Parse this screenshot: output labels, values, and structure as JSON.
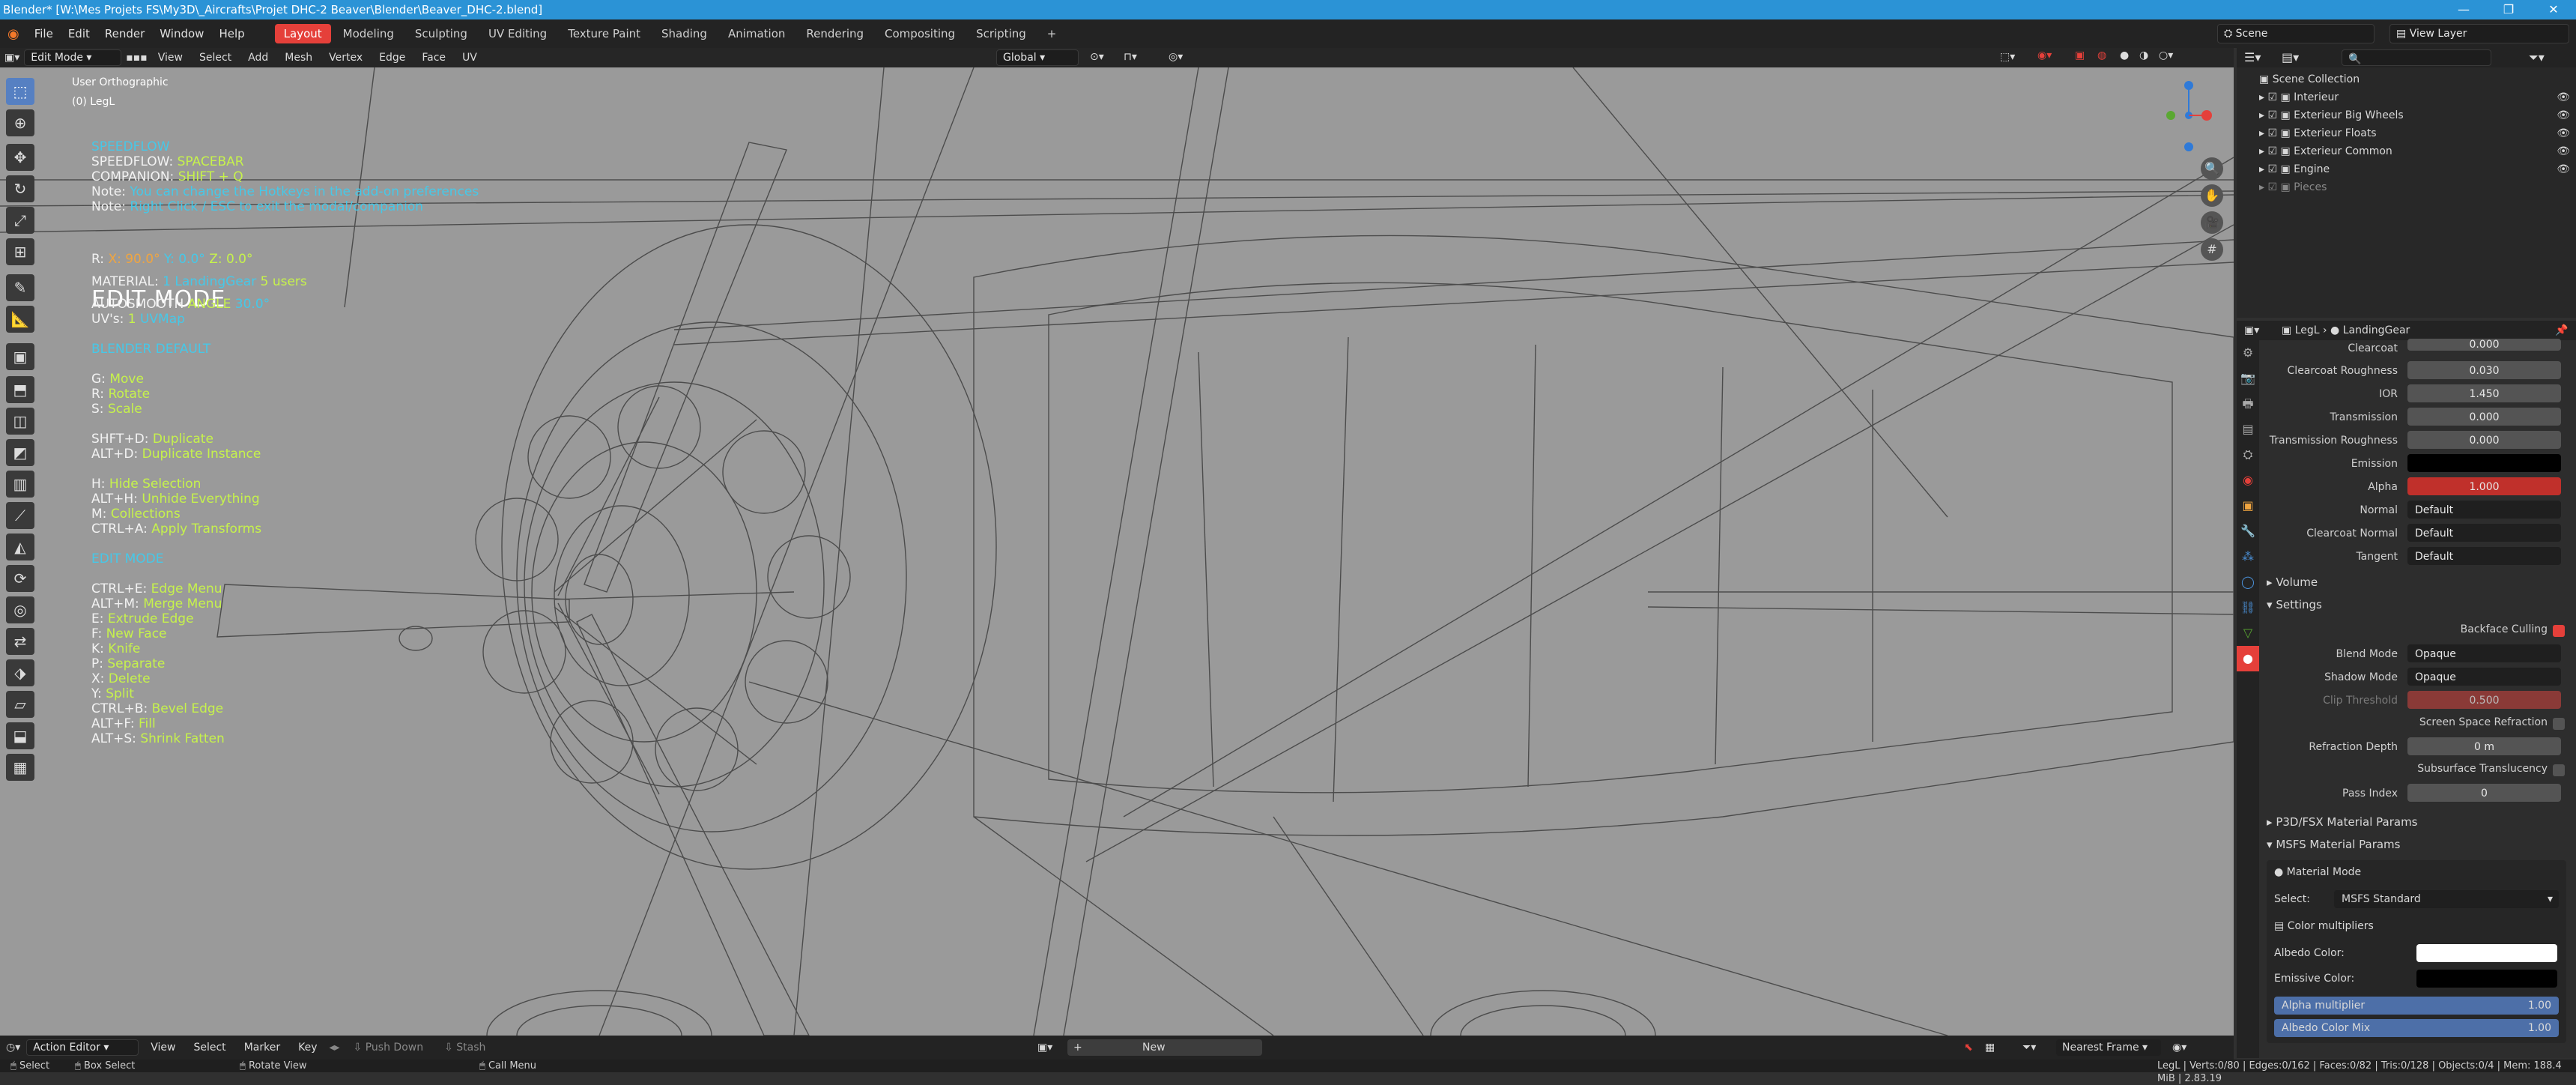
{
  "window": {
    "title": "Blender* [W:\\Mes Projets FS\\My3D\\_Aircrafts\\Projet DHC-2 Beaver\\Blender\\Beaver_DHC-2.blend]"
  },
  "menu": [
    "File",
    "Edit",
    "Render",
    "Window",
    "Help"
  ],
  "workspaces": [
    "Layout",
    "Modeling",
    "Sculpting",
    "UV Editing",
    "Texture Paint",
    "Shading",
    "Animation",
    "Rendering",
    "Compositing",
    "Scripting"
  ],
  "active_workspace": "Layout",
  "scene": "Scene",
  "view_layer": "View Layer",
  "viewport": {
    "mode": "Edit Mode",
    "menus": [
      "View",
      "Select",
      "Add",
      "Mesh",
      "Vertex",
      "Edge",
      "Face",
      "UV"
    ],
    "orientation": "Global",
    "view_label": "User Orthographic",
    "object_label": "(0) LegL"
  },
  "overlay": {
    "title_line": "SPEEDFLOW",
    "speedflow_key": "SPEEDFLOW:",
    "speedflow_val": "SPACEBAR",
    "companion_key": "COMPANION:",
    "companion_val": "SHIFT + Q",
    "note1_key": "Note:",
    "note1_val": "You can change the Hotkeys in the add-on preferences",
    "note2_key": "Note:",
    "note2_val": "Right Click / ESC to exit the modal/companion",
    "mode": "EDIT MODE",
    "r_line_key": "R:",
    "r_x": "X: 90.0°",
    "r_y": "Y: 0.0°",
    "r_z": "Z: 0.0°",
    "material_key": "MATERIAL:",
    "material_count": "1",
    "material_name": "LandingGear",
    "material_users": "5 users",
    "autosmooth_key": "AUTOSMOOTH",
    "autosmooth_angle": "ANGLE",
    "autosmooth_val": "30.0°",
    "uvs_key": "UV's:",
    "uvs_count": "1",
    "uvs_name": "UVMap",
    "section1": "BLENDER DEFAULT",
    "shortcuts1": [
      {
        "k": "G:",
        "v": "Move"
      },
      {
        "k": "R:",
        "v": "Rotate"
      },
      {
        "k": "S:",
        "v": "Scale"
      }
    ],
    "shortcuts2": [
      {
        "k": "SHFT+D:",
        "v": "Duplicate"
      },
      {
        "k": "ALT+D:",
        "v": "Duplicate Instance"
      }
    ],
    "shortcuts3": [
      {
        "k": "H:",
        "v": "Hide Selection"
      },
      {
        "k": "ALT+H:",
        "v": "Unhide Everything"
      },
      {
        "k": "M:",
        "v": "Collections"
      },
      {
        "k": "CTRL+A:",
        "v": "Apply Transforms"
      }
    ],
    "section2": "EDIT MODE",
    "shortcuts4": [
      {
        "k": "CTRL+E:",
        "v": "Edge Menu"
      },
      {
        "k": "ALT+M:",
        "v": "Merge Menu"
      },
      {
        "k": "E:",
        "v": "Extrude Edge"
      },
      {
        "k": "F:",
        "v": "New Face"
      },
      {
        "k": "K:",
        "v": "Knife"
      },
      {
        "k": "P:",
        "v": "Separate"
      },
      {
        "k": "X:",
        "v": "Delete"
      },
      {
        "k": "Y:",
        "v": "Split"
      },
      {
        "k": "CTRL+B:",
        "v": "Bevel Edge"
      },
      {
        "k": "ALT+F:",
        "v": "Fill"
      },
      {
        "k": "ALT+S:",
        "v": "Shrink Fatten"
      }
    ]
  },
  "outliner": {
    "root": "Scene Collection",
    "items": [
      "Interieur",
      "Exterieur Big Wheels",
      "Exterieur Floats",
      "Exterieur Common",
      "Engine",
      "Pieces"
    ]
  },
  "properties": {
    "breadcrumb_object": "LegL",
    "breadcrumb_material": "LandingGear",
    "rows": [
      {
        "label": "Clearcoat",
        "value": "0.000"
      },
      {
        "label": "Clearcoat Roughness",
        "value": "0.030"
      },
      {
        "label": "IOR",
        "value": "1.450"
      },
      {
        "label": "Transmission",
        "value": "0.000"
      },
      {
        "label": "Transmission Roughness",
        "value": "0.000"
      },
      {
        "label": "Emission",
        "value": ""
      },
      {
        "label": "Alpha",
        "value": "1.000"
      },
      {
        "label": "Normal",
        "value": "Default"
      },
      {
        "label": "Clearcoat Normal",
        "value": "Default"
      },
      {
        "label": "Tangent",
        "value": "Default"
      }
    ],
    "volume": "Volume",
    "settings": "Settings",
    "backface_culling": "Backface Culling",
    "blend_mode_label": "Blend Mode",
    "blend_mode": "Opaque",
    "shadow_mode_label": "Shadow Mode",
    "shadow_mode": "Opaque",
    "clip_label": "Clip Threshold",
    "clip_value": "0.500",
    "ssr_label": "Screen Space Refraction",
    "refr_depth_label": "Refraction Depth",
    "refr_depth": "0 m",
    "sss_label": "Subsurface Translucency",
    "pass_index_label": "Pass Index",
    "pass_index": "0",
    "p3d_panel": "P3D/FSX Material Params",
    "msfs_panel": "MSFS Material Params",
    "material_mode": "Material Mode",
    "select_label": "Select:",
    "select_value": "MSFS Standard",
    "color_mult": "Color multipliers",
    "albedo_label": "Albedo Color:",
    "emissive_label": "Emissive Color:",
    "alpha_mult_label": "Alpha multiplier",
    "alpha_mult": "1.00",
    "albedo_mix_label": "Albedo Color Mix",
    "albedo_mix": "1.00"
  },
  "timeline": {
    "editor": "Action Editor",
    "menus": [
      "View",
      "Select",
      "Marker",
      "Key"
    ],
    "push_down": "Push Down",
    "stash": "Stash",
    "new": "New",
    "snap": "Nearest Frame"
  },
  "status": {
    "select": "Select",
    "box_select": "Box Select",
    "rotate_view": "Rotate View",
    "call_menu": "Call Menu",
    "stats": "LegL | Verts:0/80 | Edges:0/162 | Faces:0/82 | Tris:0/128 | Objects:0/4 | Mem: 188.4 MiB | 2.83.19"
  },
  "colors": {
    "accent": "#e5403a",
    "title_bar": "#2b93d6",
    "overlay_green": "#c6f24c",
    "overlay_cyan": "#46c8e8",
    "viewport_bg": "#9a9a9a"
  }
}
